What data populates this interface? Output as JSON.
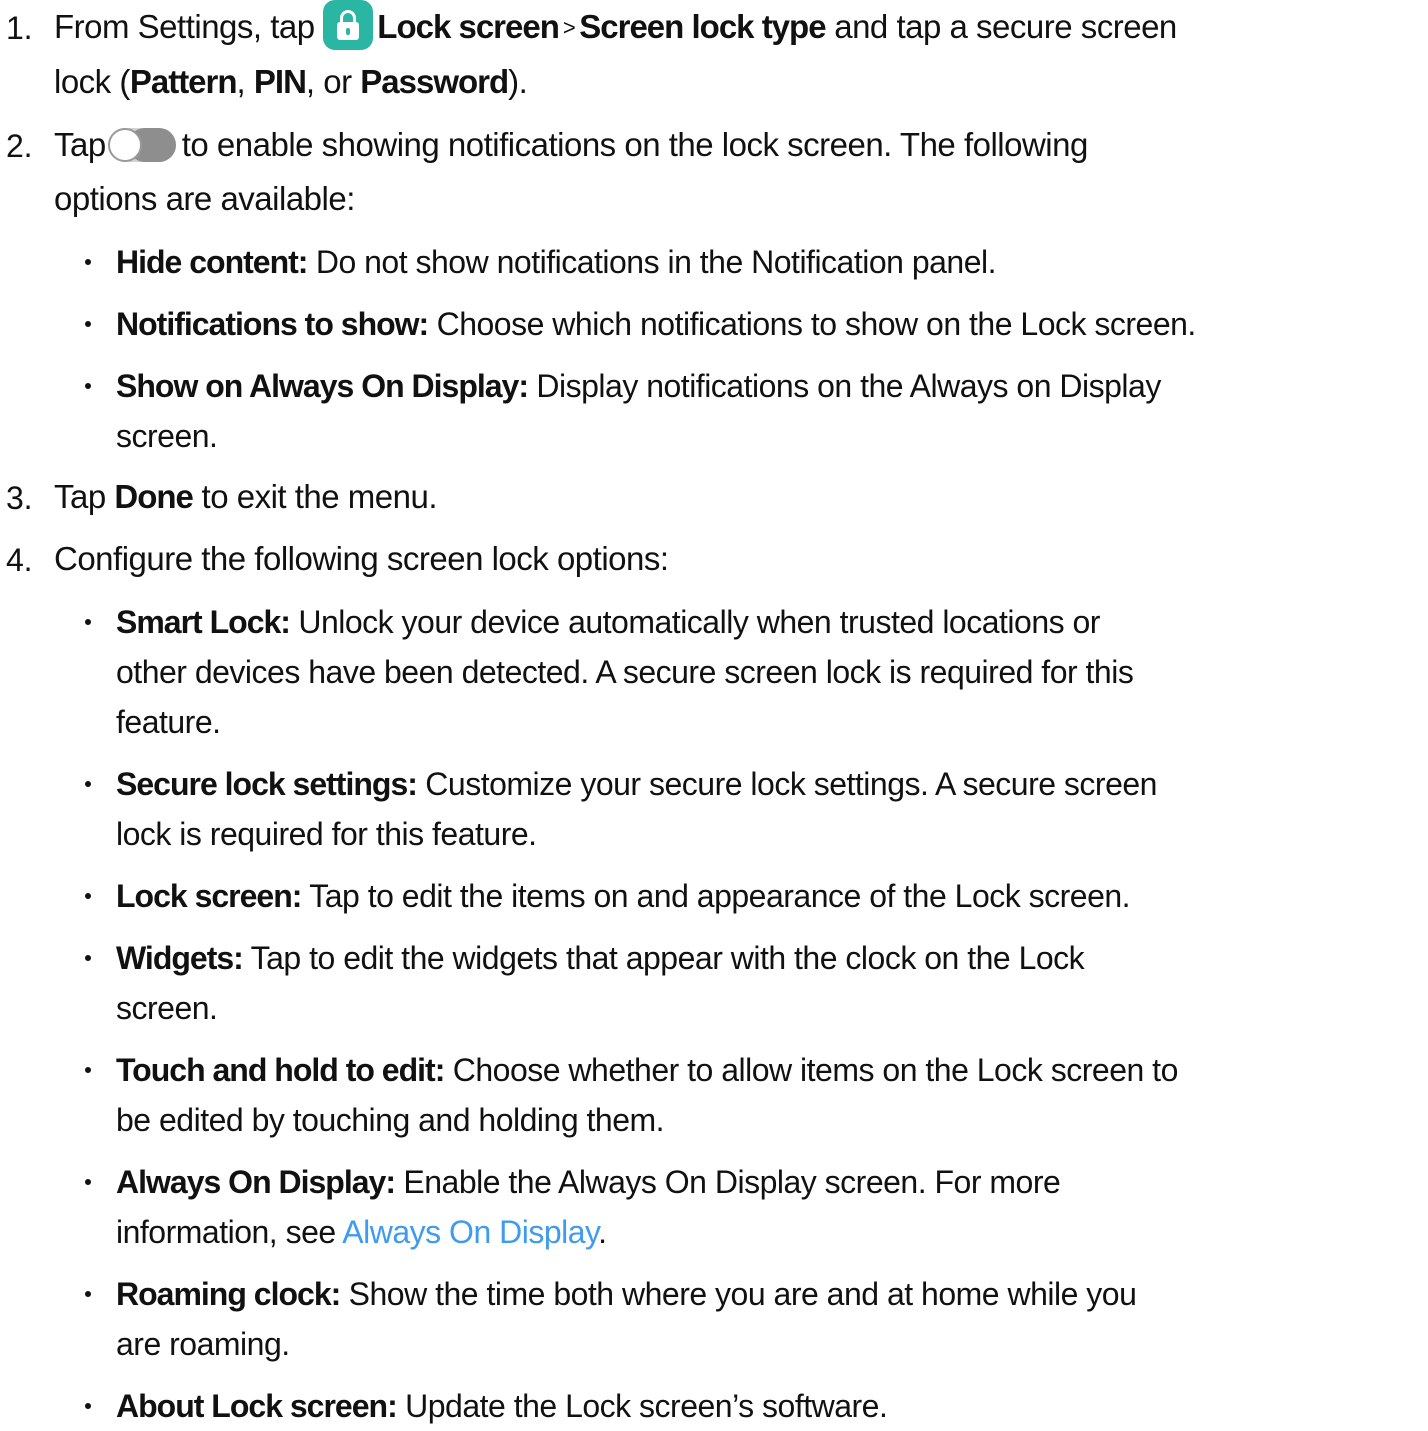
{
  "steps": [
    {
      "number": "1.",
      "parts": {
        "t1": "From Settings, tap ",
        "icon": "lock-app-icon",
        "b1": "Lock screen",
        "sep": ">",
        "b2": "Screen lock type",
        "t2": " and tap a secure screen",
        "t3": "lock (",
        "b3": "Pattern",
        "t4": ", ",
        "b4": "PIN",
        "t5": ", or ",
        "b5": "Password",
        "t6": ")."
      }
    },
    {
      "number": "2.",
      "parts": {
        "t1": "Tap",
        "icon": "toggle-switch-icon",
        "t2": "to enable showing notifications on the lock screen. The following",
        "t3": "options are available:"
      },
      "bullets": [
        {
          "label": "Hide content:",
          "text": " Do not show notifications in the Notification panel."
        },
        {
          "label": "Notifications to show:",
          "text": " Choose which notifications to show on the Lock screen."
        },
        {
          "label": "Show on Always On Display:",
          "text": " Display notifications on the Always on Display",
          "text2": "screen."
        }
      ]
    },
    {
      "number": "3.",
      "parts": {
        "t1": "Tap ",
        "b1": "Done",
        "t2": " to exit the menu."
      }
    },
    {
      "number": "4.",
      "parts": {
        "t1": "Configure the following screen lock options:"
      },
      "bullets": [
        {
          "label": "Smart Lock:",
          "text": " Unlock your device automatically when trusted locations or",
          "text2": "other devices have been detected. A secure screen lock is required for this",
          "text3": "feature."
        },
        {
          "label": "Secure lock settings:",
          "text": " Customize your secure lock settings. A secure screen",
          "text2": "lock is required for this feature."
        },
        {
          "label": "Lock screen:",
          "text": " Tap to edit the items on and appearance of the Lock screen."
        },
        {
          "label": "Widgets:",
          "text": " Tap to edit the widgets that appear with the clock on the Lock",
          "text2": "screen."
        },
        {
          "label": "Touch and hold to edit:",
          "text": " Choose whether to allow items on the Lock screen to",
          "text2": "be edited by touching and holding them."
        },
        {
          "label": "Always On Display:",
          "text": " Enable the Always On Display screen. For more",
          "text2": "information, see ",
          "link": "Always On Display",
          "text3": "."
        },
        {
          "label": "Roaming clock:",
          "text": " Show the time both where you are and at home while you",
          "text2": "are roaming."
        },
        {
          "label": "About Lock screen:",
          "text": " Update the Lock screen’s software."
        }
      ]
    }
  ],
  "colors": {
    "text": "#111111",
    "link": "#3f9bee",
    "lock_icon_bg": "#2bb6a3",
    "toggle_dark": "#8e8e8e"
  }
}
